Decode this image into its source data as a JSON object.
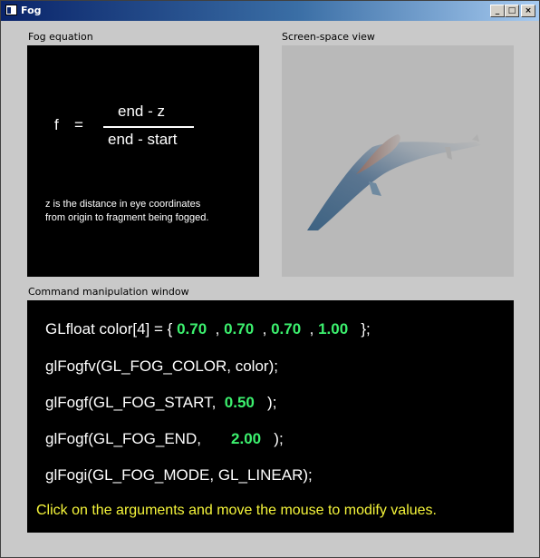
{
  "window": {
    "title": "Fog",
    "minimize_glyph": "_",
    "maximize_glyph": "□",
    "close_glyph": "×"
  },
  "equation_panel": {
    "label": "Fog equation",
    "f": "f",
    "equals": "=",
    "numerator": "end - z",
    "denominator": "end - start",
    "note_line1": "z is the distance in eye coordinates",
    "note_line2": "from origin to fragment being fogged."
  },
  "view_panel": {
    "label": "Screen-space view",
    "background": "#b9b9b9",
    "object_icon": "fighter-jet"
  },
  "command_panel": {
    "label": "Command manipulation window",
    "line1_prefix": "GLfloat color[4] = { ",
    "color_r": "0.70",
    "sep1": "  , ",
    "color_g": "0.70",
    "sep2": "  , ",
    "color_b": "0.70",
    "sep3": "  , ",
    "color_a": "1.00",
    "line1_suffix": "   };",
    "line2": "glFogfv(GL_FOG_COLOR, color);",
    "line3_prefix": "glFogf(GL_FOG_START,  ",
    "fog_start": "0.50",
    "line3_suffix": "   );",
    "line4_prefix": "glFogf(GL_FOG_END,       ",
    "fog_end": "2.00",
    "line4_suffix": "   );",
    "line5": "glFogi(GL_FOG_MODE, GL_LINEAR);",
    "hint": "Click on the arguments and move the mouse to modify values."
  },
  "colors": {
    "value_green": "#3cf06e",
    "hint_yellow": "#f5f53a",
    "panel_black": "#000000"
  }
}
